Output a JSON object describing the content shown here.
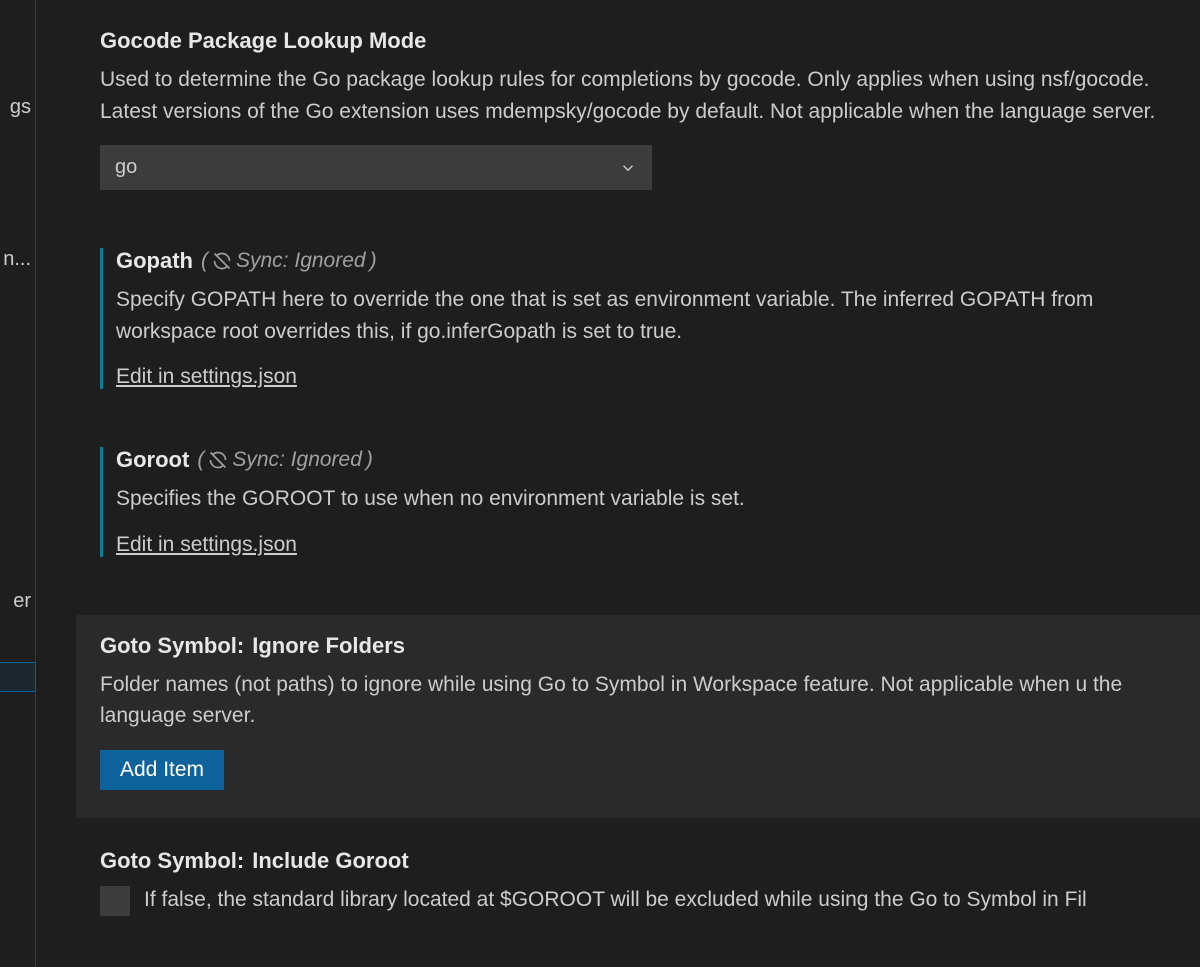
{
  "sidebar": {
    "snippets": {
      "a": "gs",
      "b": "n...",
      "c": "er"
    }
  },
  "settings": {
    "gocodePackageLookup": {
      "title": "Gocode Package Lookup Mode",
      "description": "Used to determine the Go package lookup rules for completions by gocode. Only applies when using nsf/gocode. Latest versions of the Go extension uses mdempsky/gocode by default. Not applicable when the language server.",
      "value": "go"
    },
    "gopath": {
      "title": "Gopath",
      "sync": "Sync: Ignored",
      "description": "Specify GOPATH here to override the one that is set as environment variable. The inferred GOPATH from workspace root overrides this, if go.inferGopath is set to true.",
      "link": "Edit in settings.json"
    },
    "goroot": {
      "title": "Goroot",
      "sync": "Sync: Ignored",
      "description": "Specifies the GOROOT to use when no environment variable is set.",
      "link": "Edit in settings.json"
    },
    "gotoSymbolIgnore": {
      "prefix": "Goto Symbol:",
      "suffix": "Ignore Folders",
      "description": "Folder names (not paths) to ignore while using Go to Symbol in Workspace feature. Not applicable when u the language server.",
      "button": "Add Item"
    },
    "gotoSymbolInclude": {
      "prefix": "Goto Symbol:",
      "suffix": "Include Goroot",
      "description": "If false, the standard library located at $GOROOT will be excluded while using the Go to Symbol in Fil"
    }
  }
}
